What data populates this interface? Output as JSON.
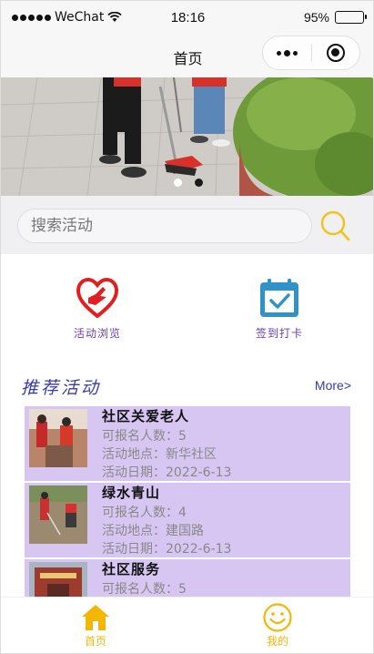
{
  "status_bar": {
    "carrier": "WeChat",
    "time": "18:16",
    "battery": "95%",
    "battery_level": 0.95
  },
  "nav": {
    "title": "首页"
  },
  "banner": {
    "slide_count": 3,
    "active_index": 0
  },
  "search": {
    "placeholder": "搜索活动"
  },
  "quick_links": [
    {
      "label": "活动浏览",
      "icon": "heart-hand-icon"
    },
    {
      "label": "签到打卡",
      "icon": "calendar-check-icon"
    }
  ],
  "section": {
    "title": "推荐活动",
    "more": "More>"
  },
  "activities": [
    {
      "name": "社区关爱老人",
      "quota": "可报名人数：5",
      "place": "活动地点：新华社区",
      "date": "活动日期：2022-6-13"
    },
    {
      "name": "绿水青山",
      "quota": "可报名人数：4",
      "place": "活动地点：建国路",
      "date": "活动日期：2022-6-13"
    },
    {
      "name": "社区服务",
      "quota": "可报名人数：5",
      "place": "",
      "date": ""
    }
  ],
  "tabs": [
    {
      "label": "首页",
      "icon": "home-icon"
    },
    {
      "label": "我的",
      "icon": "smiley-icon"
    }
  ],
  "colors": {
    "accent": "#f2b705",
    "card_bg": "#d7c6f2",
    "section_title": "#3a3aa8"
  }
}
